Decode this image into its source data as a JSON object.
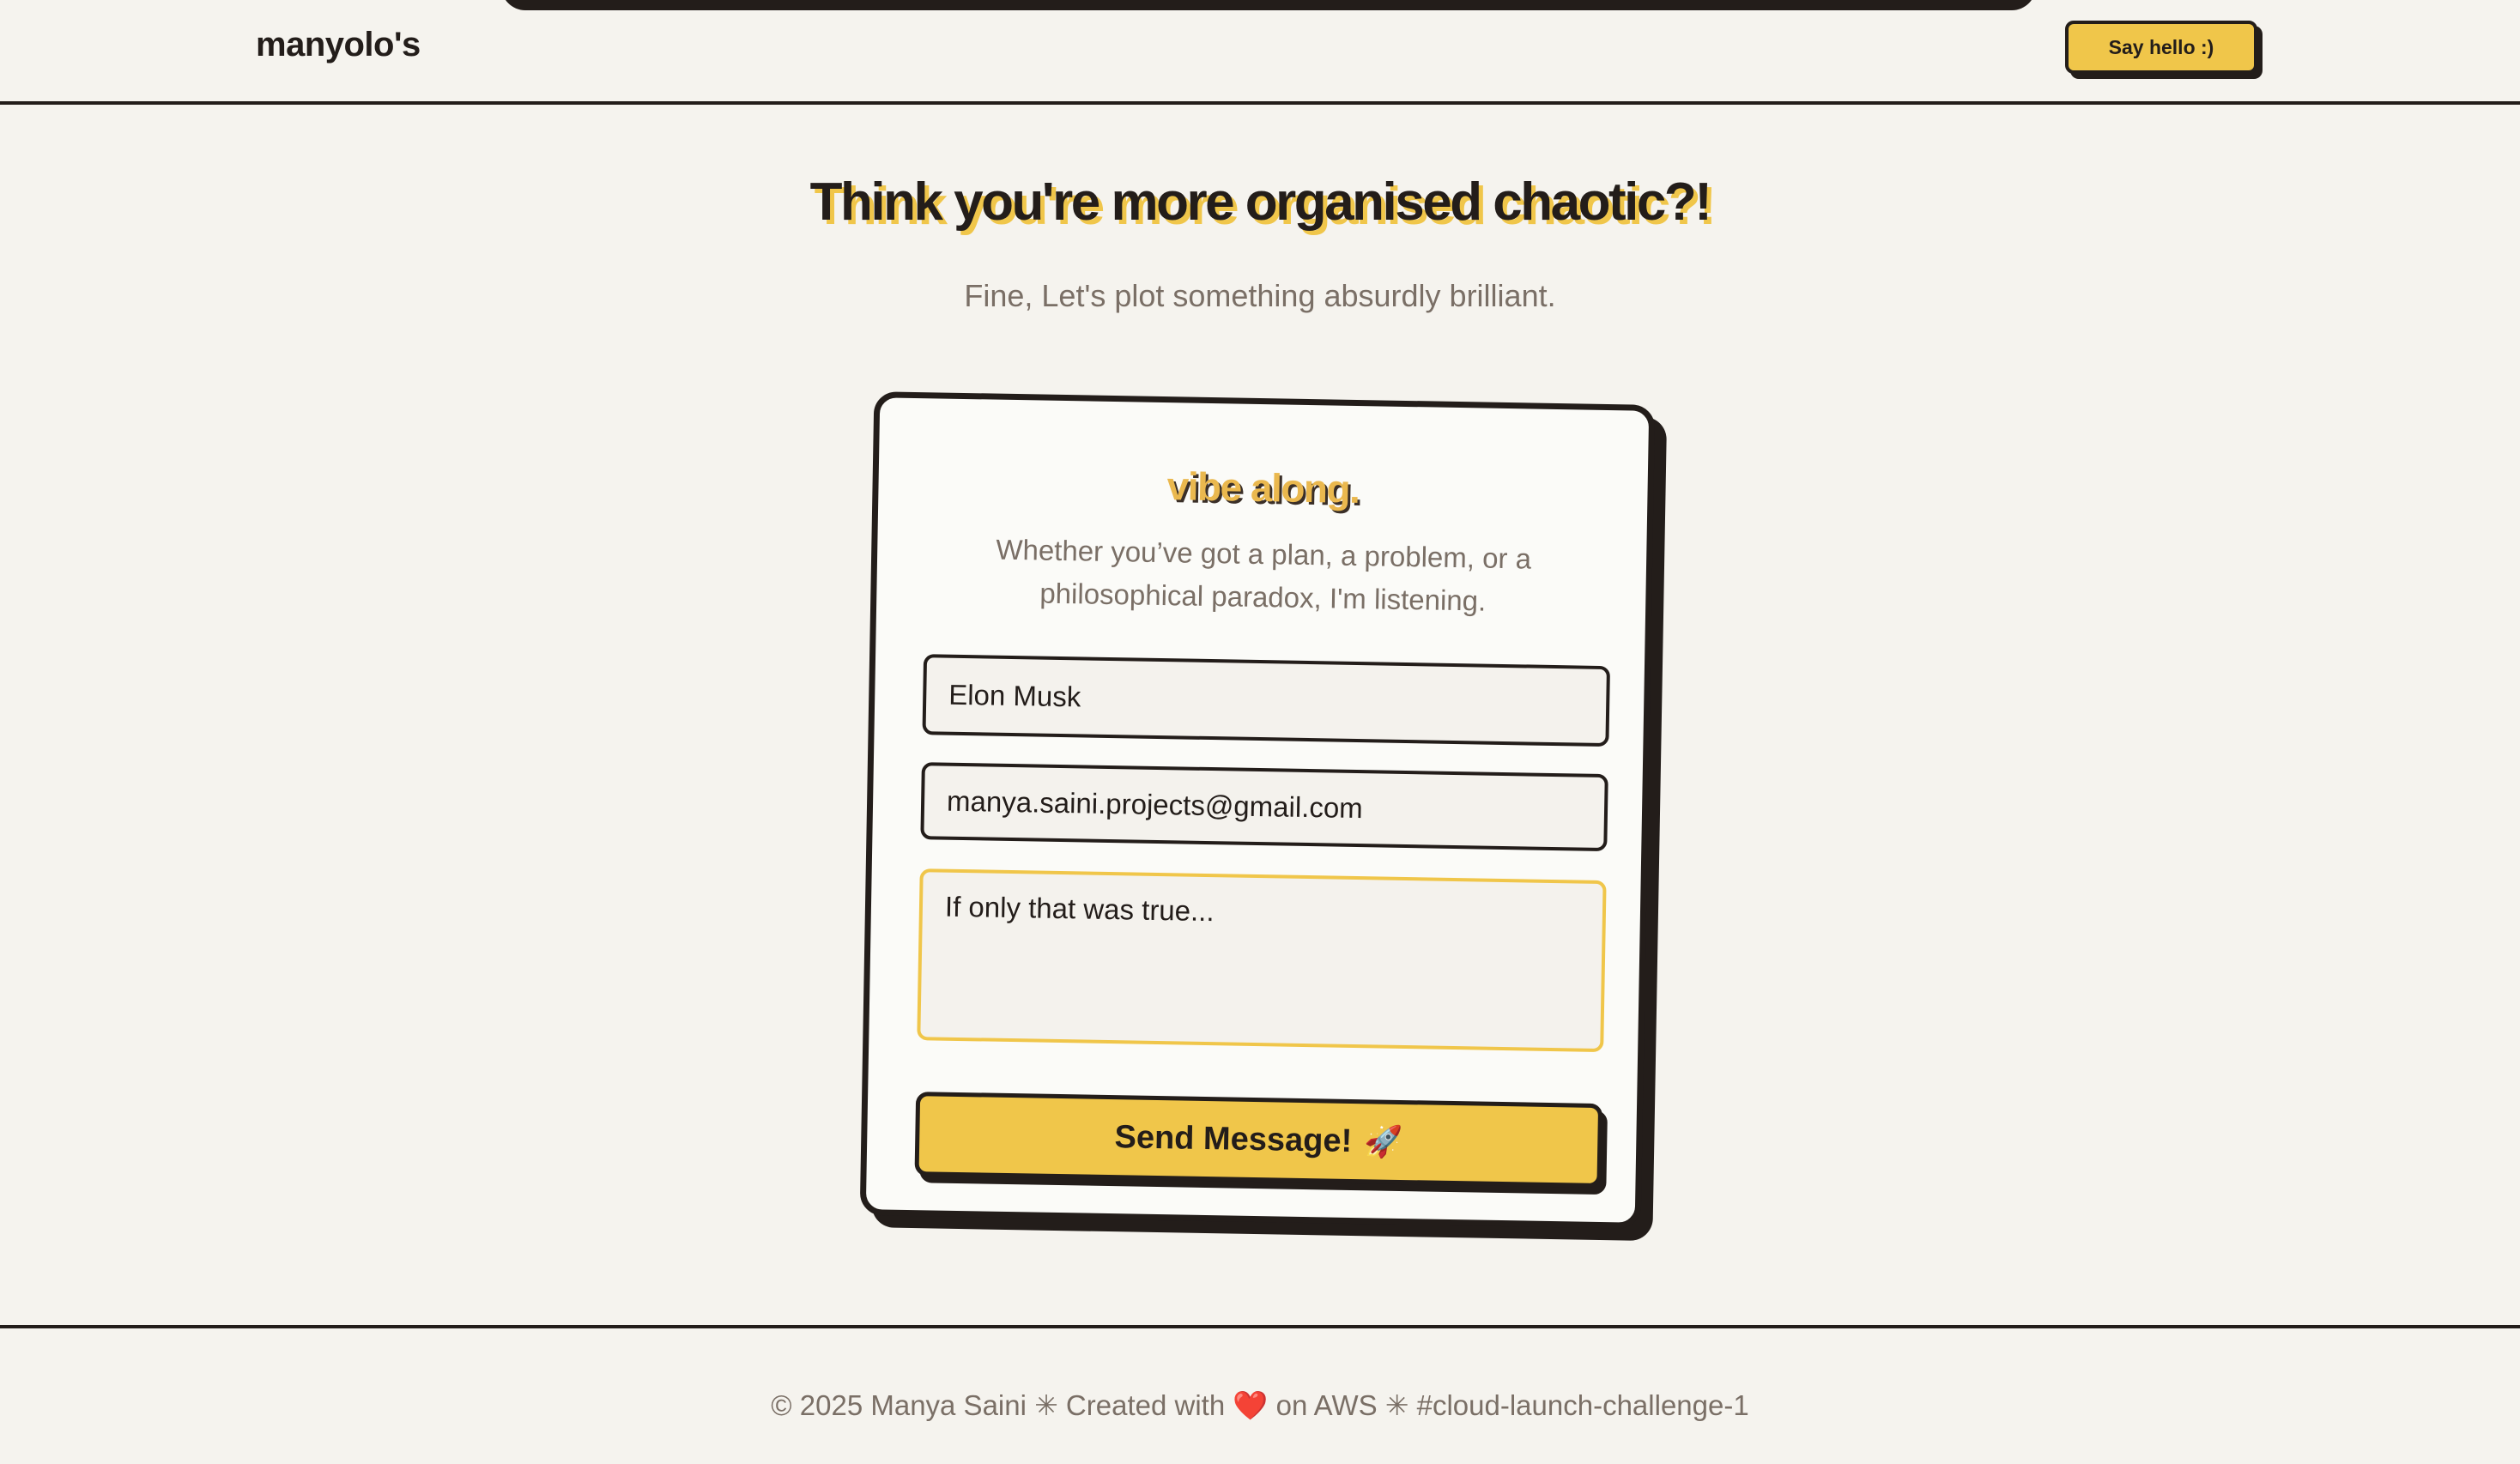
{
  "header": {
    "brand": "manyolo's",
    "cta_label": "Say hello :)"
  },
  "hero": {
    "title": "Think you're more organised chaotic?!",
    "subtitle": "Fine, Let's plot something absurdly brilliant."
  },
  "card": {
    "title": "vibe along.",
    "description": "Whether you’ve got a plan, a problem, or a philosophical paradox, I'm listening.",
    "name_value": "Elon Musk",
    "email_value": "manya.saini.projects@gmail.com",
    "message_value": "If only that was true...",
    "submit_label": "Send Message!",
    "submit_icon": "🚀"
  },
  "footer": {
    "prefix": "© 2025 Manya Saini ✳ Created with",
    "heart": "❤️",
    "suffix": "on AWS ✳ #cloud-launch-challenge-1"
  },
  "colors": {
    "accent": "#f0c64a",
    "ink": "#231d1a",
    "background": "#f5f3ee",
    "muted_text": "#7a6f66"
  }
}
